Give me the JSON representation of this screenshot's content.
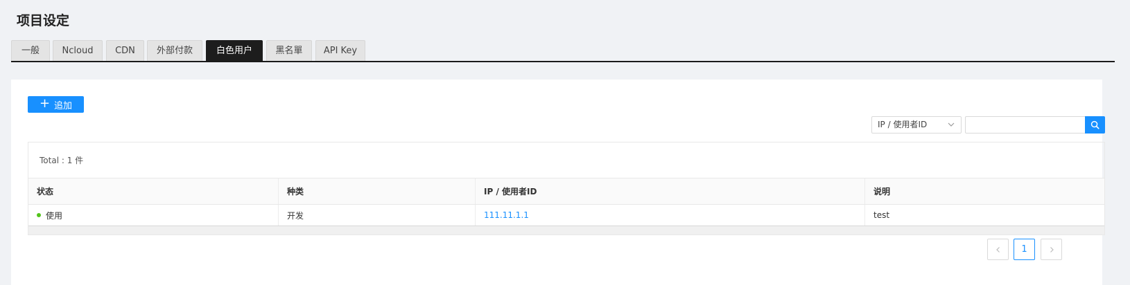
{
  "page_title": "项目设定",
  "tabs": [
    {
      "label": "一般",
      "active": false
    },
    {
      "label": "Ncloud",
      "active": false
    },
    {
      "label": "CDN",
      "active": false
    },
    {
      "label": "外部付款",
      "active": false
    },
    {
      "label": "白色用户",
      "active": true
    },
    {
      "label": "黑名單",
      "active": false
    },
    {
      "label": "API Key",
      "active": false
    }
  ],
  "toolbar": {
    "add_label": "追加",
    "search_field_selected": "IP / 使用者ID",
    "search_value": ""
  },
  "table": {
    "total_text": "Total : 1 件",
    "columns": [
      "状态",
      "种类",
      "IP / 使用者ID",
      "说明"
    ],
    "rows": [
      {
        "status": "使用",
        "type": "开发",
        "ip_user_id": "111.11.1.1",
        "description": "test"
      }
    ]
  },
  "pagination": {
    "current_page": "1",
    "prev_icon": "chevron-left-icon",
    "next_icon": "chevron-right-icon"
  },
  "colors": {
    "accent": "#1890ff",
    "active_tab": "#1d1d1d",
    "status_active": "#52c41a",
    "background": "#f0f2f5"
  }
}
